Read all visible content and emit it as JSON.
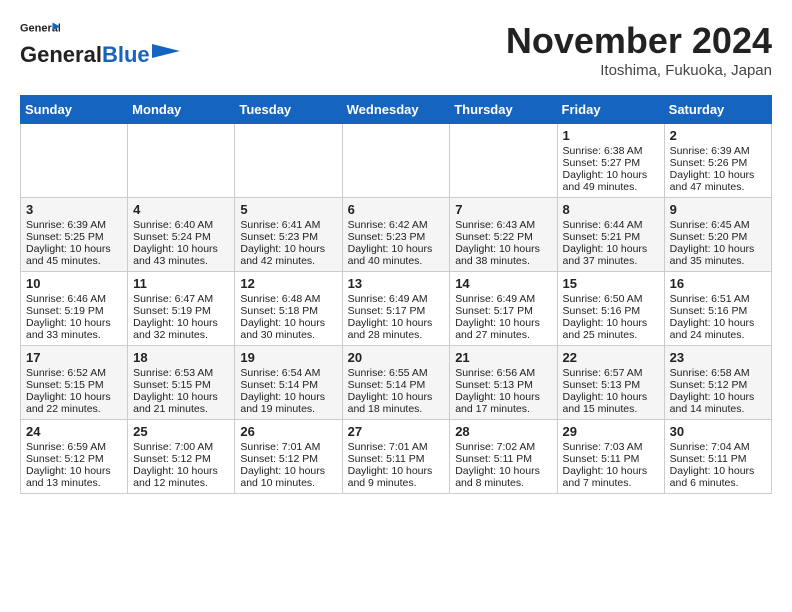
{
  "header": {
    "logo_line1": "General",
    "logo_line2": "Blue",
    "month": "November 2024",
    "location": "Itoshima, Fukuoka, Japan"
  },
  "days_of_week": [
    "Sunday",
    "Monday",
    "Tuesday",
    "Wednesday",
    "Thursday",
    "Friday",
    "Saturday"
  ],
  "weeks": [
    [
      {
        "day": "",
        "info": ""
      },
      {
        "day": "",
        "info": ""
      },
      {
        "day": "",
        "info": ""
      },
      {
        "day": "",
        "info": ""
      },
      {
        "day": "",
        "info": ""
      },
      {
        "day": "1",
        "info": "Sunrise: 6:38 AM\nSunset: 5:27 PM\nDaylight: 10 hours\nand 49 minutes."
      },
      {
        "day": "2",
        "info": "Sunrise: 6:39 AM\nSunset: 5:26 PM\nDaylight: 10 hours\nand 47 minutes."
      }
    ],
    [
      {
        "day": "3",
        "info": "Sunrise: 6:39 AM\nSunset: 5:25 PM\nDaylight: 10 hours\nand 45 minutes."
      },
      {
        "day": "4",
        "info": "Sunrise: 6:40 AM\nSunset: 5:24 PM\nDaylight: 10 hours\nand 43 minutes."
      },
      {
        "day": "5",
        "info": "Sunrise: 6:41 AM\nSunset: 5:23 PM\nDaylight: 10 hours\nand 42 minutes."
      },
      {
        "day": "6",
        "info": "Sunrise: 6:42 AM\nSunset: 5:23 PM\nDaylight: 10 hours\nand 40 minutes."
      },
      {
        "day": "7",
        "info": "Sunrise: 6:43 AM\nSunset: 5:22 PM\nDaylight: 10 hours\nand 38 minutes."
      },
      {
        "day": "8",
        "info": "Sunrise: 6:44 AM\nSunset: 5:21 PM\nDaylight: 10 hours\nand 37 minutes."
      },
      {
        "day": "9",
        "info": "Sunrise: 6:45 AM\nSunset: 5:20 PM\nDaylight: 10 hours\nand 35 minutes."
      }
    ],
    [
      {
        "day": "10",
        "info": "Sunrise: 6:46 AM\nSunset: 5:19 PM\nDaylight: 10 hours\nand 33 minutes."
      },
      {
        "day": "11",
        "info": "Sunrise: 6:47 AM\nSunset: 5:19 PM\nDaylight: 10 hours\nand 32 minutes."
      },
      {
        "day": "12",
        "info": "Sunrise: 6:48 AM\nSunset: 5:18 PM\nDaylight: 10 hours\nand 30 minutes."
      },
      {
        "day": "13",
        "info": "Sunrise: 6:49 AM\nSunset: 5:17 PM\nDaylight: 10 hours\nand 28 minutes."
      },
      {
        "day": "14",
        "info": "Sunrise: 6:49 AM\nSunset: 5:17 PM\nDaylight: 10 hours\nand 27 minutes."
      },
      {
        "day": "15",
        "info": "Sunrise: 6:50 AM\nSunset: 5:16 PM\nDaylight: 10 hours\nand 25 minutes."
      },
      {
        "day": "16",
        "info": "Sunrise: 6:51 AM\nSunset: 5:16 PM\nDaylight: 10 hours\nand 24 minutes."
      }
    ],
    [
      {
        "day": "17",
        "info": "Sunrise: 6:52 AM\nSunset: 5:15 PM\nDaylight: 10 hours\nand 22 minutes."
      },
      {
        "day": "18",
        "info": "Sunrise: 6:53 AM\nSunset: 5:15 PM\nDaylight: 10 hours\nand 21 minutes."
      },
      {
        "day": "19",
        "info": "Sunrise: 6:54 AM\nSunset: 5:14 PM\nDaylight: 10 hours\nand 19 minutes."
      },
      {
        "day": "20",
        "info": "Sunrise: 6:55 AM\nSunset: 5:14 PM\nDaylight: 10 hours\nand 18 minutes."
      },
      {
        "day": "21",
        "info": "Sunrise: 6:56 AM\nSunset: 5:13 PM\nDaylight: 10 hours\nand 17 minutes."
      },
      {
        "day": "22",
        "info": "Sunrise: 6:57 AM\nSunset: 5:13 PM\nDaylight: 10 hours\nand 15 minutes."
      },
      {
        "day": "23",
        "info": "Sunrise: 6:58 AM\nSunset: 5:12 PM\nDaylight: 10 hours\nand 14 minutes."
      }
    ],
    [
      {
        "day": "24",
        "info": "Sunrise: 6:59 AM\nSunset: 5:12 PM\nDaylight: 10 hours\nand 13 minutes."
      },
      {
        "day": "25",
        "info": "Sunrise: 7:00 AM\nSunset: 5:12 PM\nDaylight: 10 hours\nand 12 minutes."
      },
      {
        "day": "26",
        "info": "Sunrise: 7:01 AM\nSunset: 5:12 PM\nDaylight: 10 hours\nand 10 minutes."
      },
      {
        "day": "27",
        "info": "Sunrise: 7:01 AM\nSunset: 5:11 PM\nDaylight: 10 hours\nand 9 minutes."
      },
      {
        "day": "28",
        "info": "Sunrise: 7:02 AM\nSunset: 5:11 PM\nDaylight: 10 hours\nand 8 minutes."
      },
      {
        "day": "29",
        "info": "Sunrise: 7:03 AM\nSunset: 5:11 PM\nDaylight: 10 hours\nand 7 minutes."
      },
      {
        "day": "30",
        "info": "Sunrise: 7:04 AM\nSunset: 5:11 PM\nDaylight: 10 hours\nand 6 minutes."
      }
    ]
  ]
}
